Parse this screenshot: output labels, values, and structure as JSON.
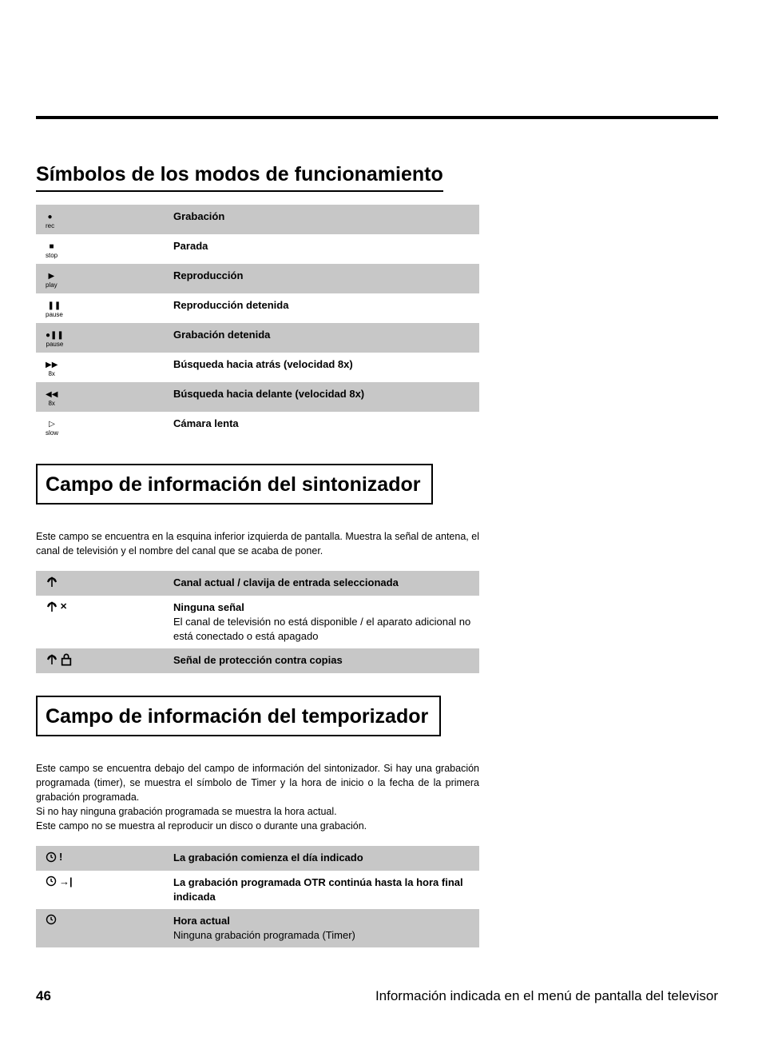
{
  "page_number": "46",
  "footer_title": "Información indicada en el menú de pantalla del televisor",
  "section1": {
    "title": "Símbolos de los modos de funcionamiento",
    "rows": [
      {
        "icon_label": "rec",
        "desc": "Grabación"
      },
      {
        "icon_label": "stop",
        "desc": "Parada"
      },
      {
        "icon_label": "play",
        "desc": "Reproducción"
      },
      {
        "icon_label": "pause",
        "desc": "Reproducción detenida"
      },
      {
        "icon_label": "pause",
        "desc": "Grabación detenida"
      },
      {
        "icon_label": "8x",
        "desc": "Búsqueda hacia atrás (velocidad 8x)"
      },
      {
        "icon_label": "8x",
        "desc": "Búsqueda hacia delante (velocidad 8x)"
      },
      {
        "icon_label": "slow",
        "desc": "Cámara lenta"
      }
    ]
  },
  "section2": {
    "title": "Campo de información del sintonizador",
    "intro": "Este campo se encuentra en la esquina inferior izquierda de pantalla. Muestra la señal de antena, el canal de televisión y el nombre del canal que se acaba de poner.",
    "rows": [
      {
        "desc": "Canal actual / clavija de entrada seleccionada"
      },
      {
        "desc": "Ninguna señal",
        "sub": "El canal de televisión no está disponible / el aparato adicional no está conectado o está apagado"
      },
      {
        "desc": "Señal de protección contra copias"
      }
    ]
  },
  "section3": {
    "title": "Campo de información del temporizador",
    "intro": "Este campo se encuentra debajo del campo de información del sintonizador. Si hay una grabación programada (timer), se muestra el símbolo de Timer y la hora de inicio o la fecha de la primera grabación programada.\nSi no hay ninguna grabación programada se muestra la hora actual.\nEste campo no se muestra al reproducir un disco o durante una grabación.",
    "rows": [
      {
        "desc": "La grabación comienza el día indicado"
      },
      {
        "desc": "La grabación programada OTR continúa hasta la hora final indicada"
      },
      {
        "desc": "Hora actual",
        "sub": "Ninguna grabación programada (Timer)"
      }
    ]
  }
}
